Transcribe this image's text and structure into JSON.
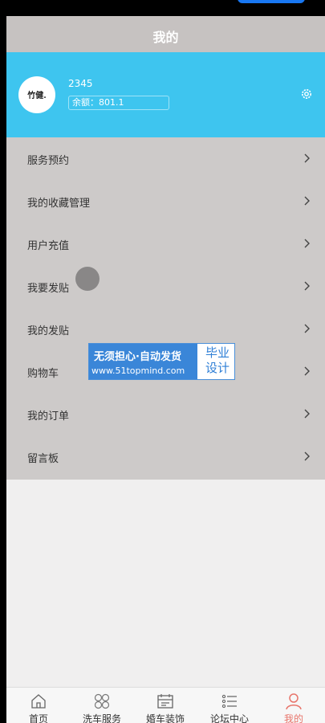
{
  "header": {
    "title": "我的"
  },
  "profile": {
    "avatar_text": "竹健.",
    "username": "2345",
    "balance": "余额：801.1"
  },
  "menu": [
    {
      "label": "服务预约"
    },
    {
      "label": "我的收藏管理"
    },
    {
      "label": "用户充值"
    },
    {
      "label": "我要发贴"
    },
    {
      "label": "我的发贴"
    },
    {
      "label": "购物车"
    },
    {
      "label": "我的订单"
    },
    {
      "label": "留言板"
    }
  ],
  "watermark": {
    "line1": "无须担心·自动发货",
    "line2": "www.51topmind.com",
    "side1": "毕业",
    "side2": "设计"
  },
  "tabs": [
    {
      "label": "首页",
      "icon": "home-icon"
    },
    {
      "label": "洗车服务",
      "icon": "grid-icon"
    },
    {
      "label": "婚车装饰",
      "icon": "calendar-icon"
    },
    {
      "label": "论坛中心",
      "icon": "list-icon"
    },
    {
      "label": "我的",
      "icon": "user-icon",
      "active": true
    }
  ],
  "colors": {
    "accent": "#3ec5ef",
    "active_tab": "#e8756b",
    "title_bar": "#c6c2c1"
  }
}
